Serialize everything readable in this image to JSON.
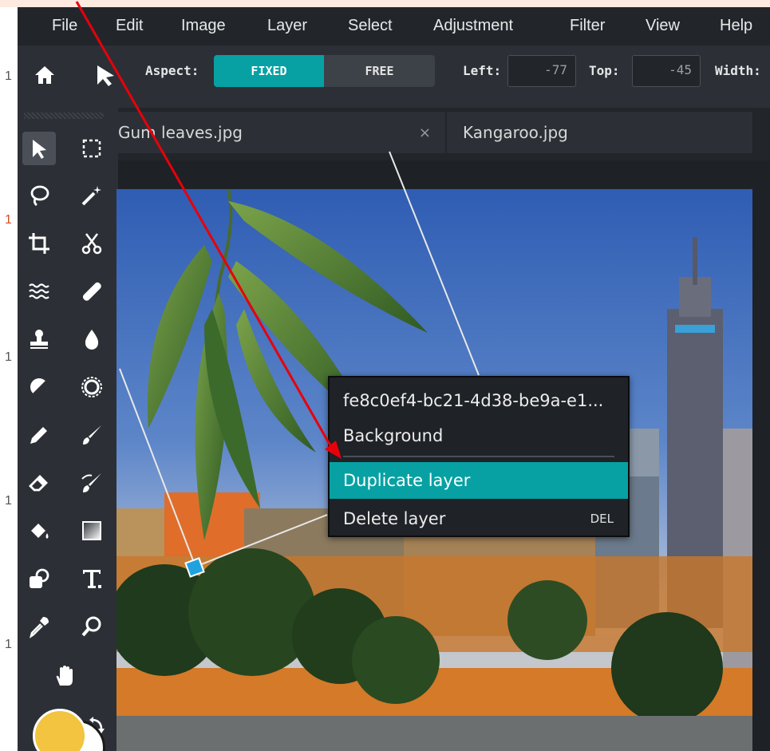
{
  "strip_numbers": [
    "1",
    "1",
    "1",
    "1",
    "1"
  ],
  "menubar": {
    "items": [
      "File",
      "Edit",
      "Image",
      "Layer",
      "Select",
      "Adjustment",
      "Filter",
      "View",
      "Help"
    ]
  },
  "toolbar": {
    "aspect_label": "Aspect:",
    "fixed_label": "FIXED",
    "free_label": "FREE",
    "left_label": "Left:",
    "left_value": "-77",
    "top_label": "Top:",
    "top_value": "-45",
    "width_label": "Width:"
  },
  "tabs": [
    {
      "label": "Gum leaves.jpg",
      "close": "×"
    },
    {
      "label": "Kangaroo.jpg"
    }
  ],
  "context_menu": {
    "items": [
      {
        "label": "fe8c0ef4-bc21-4d38-be9a-e1..."
      },
      {
        "label": "Background"
      },
      {
        "label": "Duplicate layer"
      },
      {
        "label": "Delete layer",
        "shortcut": "DEL"
      }
    ]
  },
  "colors": {
    "accent": "#07a1a3",
    "foreground_color": "#f2c43f",
    "background_color": "#ffffff",
    "annotation_arrow": "#e8000a"
  },
  "tool_icons": [
    "move-tool-icon",
    "rect-select-icon",
    "lasso-icon",
    "magic-wand-icon",
    "crop-icon",
    "cut-icon",
    "liquify-icon",
    "heal-icon",
    "clone-stamp-icon",
    "blur-icon",
    "dodge-icon",
    "sponge-icon",
    "pencil-icon",
    "brush-icon",
    "eraser-icon",
    "smudge-brush-icon",
    "fill-icon",
    "gradient-icon",
    "shape-icon",
    "text-icon",
    "eyedropper-icon",
    "zoom-icon",
    "hand-icon",
    "swap-colors-icon"
  ]
}
